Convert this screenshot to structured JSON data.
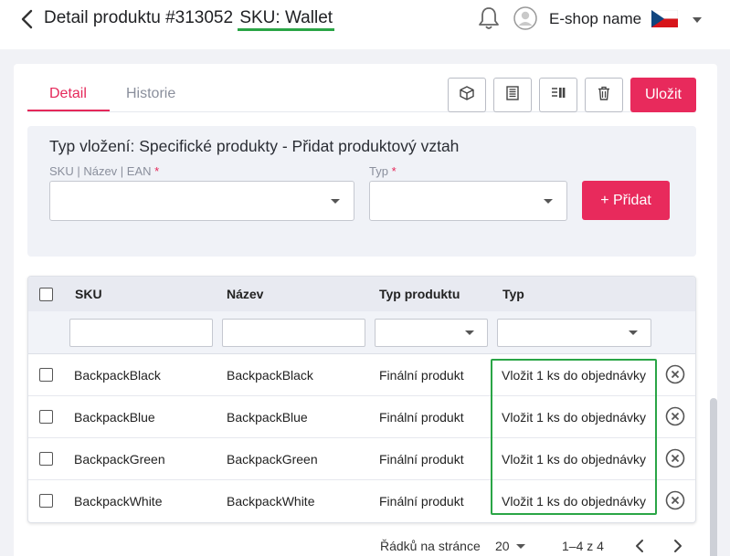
{
  "header": {
    "title_prefix": "Detail produktu #313052",
    "title_sku": "SKU: Wallet",
    "shop_name": "E-shop name"
  },
  "tabs": [
    {
      "label": "Detail"
    },
    {
      "label": "Historie"
    }
  ],
  "toolbar": {
    "save_label": "Uložit",
    "icons": [
      "box-icon",
      "barcode-list-icon",
      "columns-icon",
      "trash-icon"
    ]
  },
  "insert_panel": {
    "title": "Typ vložení: Specifické produkty - Přidat produktový vztah",
    "sku_label": "SKU | Název | EAN",
    "type_label": "Typ",
    "required_mark": "*",
    "add_label": "+ Přidat"
  },
  "table": {
    "columns": [
      "SKU",
      "Název",
      "Typ produktu",
      "Typ"
    ],
    "rows": [
      {
        "sku": "BackpackBlack",
        "name": "BackpackBlack",
        "product_type": "Finální produkt",
        "type": "Vložit 1 ks do objednávky"
      },
      {
        "sku": "BackpackBlue",
        "name": "BackpackBlue",
        "product_type": "Finální produkt",
        "type": "Vložit 1 ks do objednávky"
      },
      {
        "sku": "BackpackGreen",
        "name": "BackpackGreen",
        "product_type": "Finální produkt",
        "type": "Vložit 1 ks do objednávky"
      },
      {
        "sku": "BackpackWhite",
        "name": "BackpackWhite",
        "product_type": "Finální produkt",
        "type": "Vložit 1 ks do objednávky"
      }
    ]
  },
  "pagination": {
    "rows_per_page_label": "Řádků na stránce",
    "rows_per_page": "20",
    "range": "1–4 z 4"
  },
  "colors": {
    "accent": "#e82a5c",
    "highlight": "#2aa546"
  }
}
